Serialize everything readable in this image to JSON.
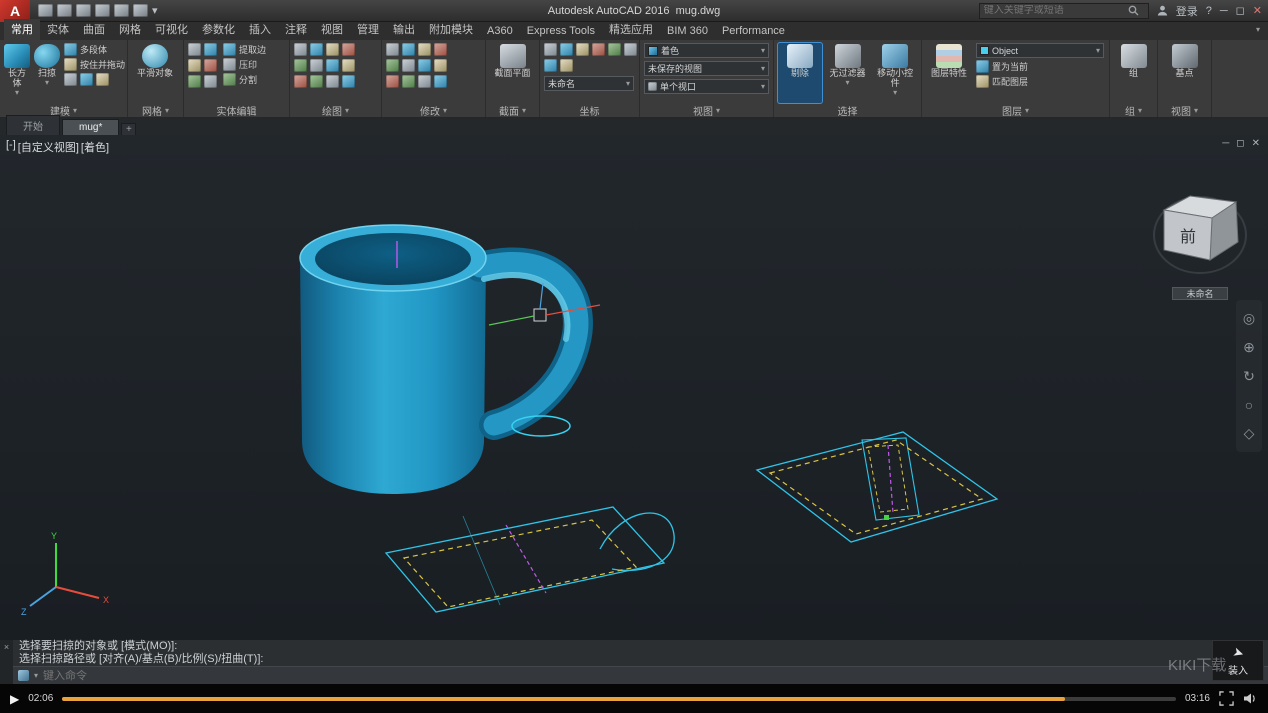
{
  "titlebar": {
    "logo": "A",
    "app_title": "Autodesk AutoCAD 2016",
    "doc_name": "mug.dwg",
    "search_placeholder": "键入关键字或短语",
    "signin": "登录"
  },
  "tabs": [
    {
      "label": "常用",
      "active": true
    },
    {
      "label": "实体"
    },
    {
      "label": "曲面"
    },
    {
      "label": "网格"
    },
    {
      "label": "可视化"
    },
    {
      "label": "参数化"
    },
    {
      "label": "插入"
    },
    {
      "label": "注释"
    },
    {
      "label": "视图"
    },
    {
      "label": "管理"
    },
    {
      "label": "输出"
    },
    {
      "label": "附加模块"
    },
    {
      "label": "A360"
    },
    {
      "label": "Express Tools"
    },
    {
      "label": "精选应用"
    },
    {
      "label": "BIM 360"
    },
    {
      "label": "Performance"
    }
  ],
  "ribbon": {
    "modeling": {
      "label": "建模",
      "box": "长方体",
      "sweep": "扫掠",
      "polysolid": "多段体",
      "presspull": "按住并拖动"
    },
    "mesh": {
      "label": "网格",
      "smooth": "平滑对象"
    },
    "solid_edit": {
      "label": "实体编辑",
      "extract": "提取边",
      "imprint": "压印",
      "separate": "分割"
    },
    "draw": {
      "label": "绘图"
    },
    "modify": {
      "label": "修改"
    },
    "section": {
      "label": "截面",
      "plane": "截面平面"
    },
    "coords": {
      "label": "坐标",
      "ucs": "未命名"
    },
    "view": {
      "label": "视图",
      "style": "着色",
      "named": "未保存的视图",
      "vports": "单个视口"
    },
    "selection": {
      "label": "选择",
      "culling": "剔除",
      "filter": "无过滤器",
      "gizmo": "移动小控件"
    },
    "layers": {
      "label": "图层",
      "props": "图层特性",
      "current": "Object",
      "make_current": "置为当前",
      "match": "匹配图层"
    },
    "groups": {
      "label": "组",
      "group": "组"
    },
    "view_right": {
      "label": "视图",
      "base": "基点"
    }
  },
  "file_tabs": {
    "start": "开始",
    "doc": "mug*",
    "add": "+"
  },
  "viewport": {
    "vc_minus": "[-]",
    "vc_view": "[自定义视图]",
    "vc_style": "[着色]",
    "cube_face": "前",
    "cube_tag": "未命名",
    "axis_x": "X",
    "axis_y": "Y",
    "axis_z": "Z"
  },
  "command": {
    "history": [
      "选择要扫掠的对象或 [模式(MO)]:",
      "选择扫掠路径或 [对齐(A)/基点(B)/比例(S)/扭曲(T)]:"
    ],
    "placeholder": "键入命令",
    "load": "装入"
  },
  "player": {
    "current": "02:06",
    "total": "03:16"
  },
  "watermark": "KIKI下载",
  "nav_icons": [
    {
      "glyph": "◎"
    },
    {
      "glyph": "⊕"
    },
    {
      "glyph": "↻"
    },
    {
      "glyph": "○"
    },
    {
      "glyph": "◇"
    }
  ],
  "window": {
    "min": "─",
    "max": "◻",
    "close": "✕"
  },
  "misc": {
    "caret": "▾",
    "play": "▶",
    "arrow": "➤",
    "help": "?",
    "cross": "×"
  }
}
